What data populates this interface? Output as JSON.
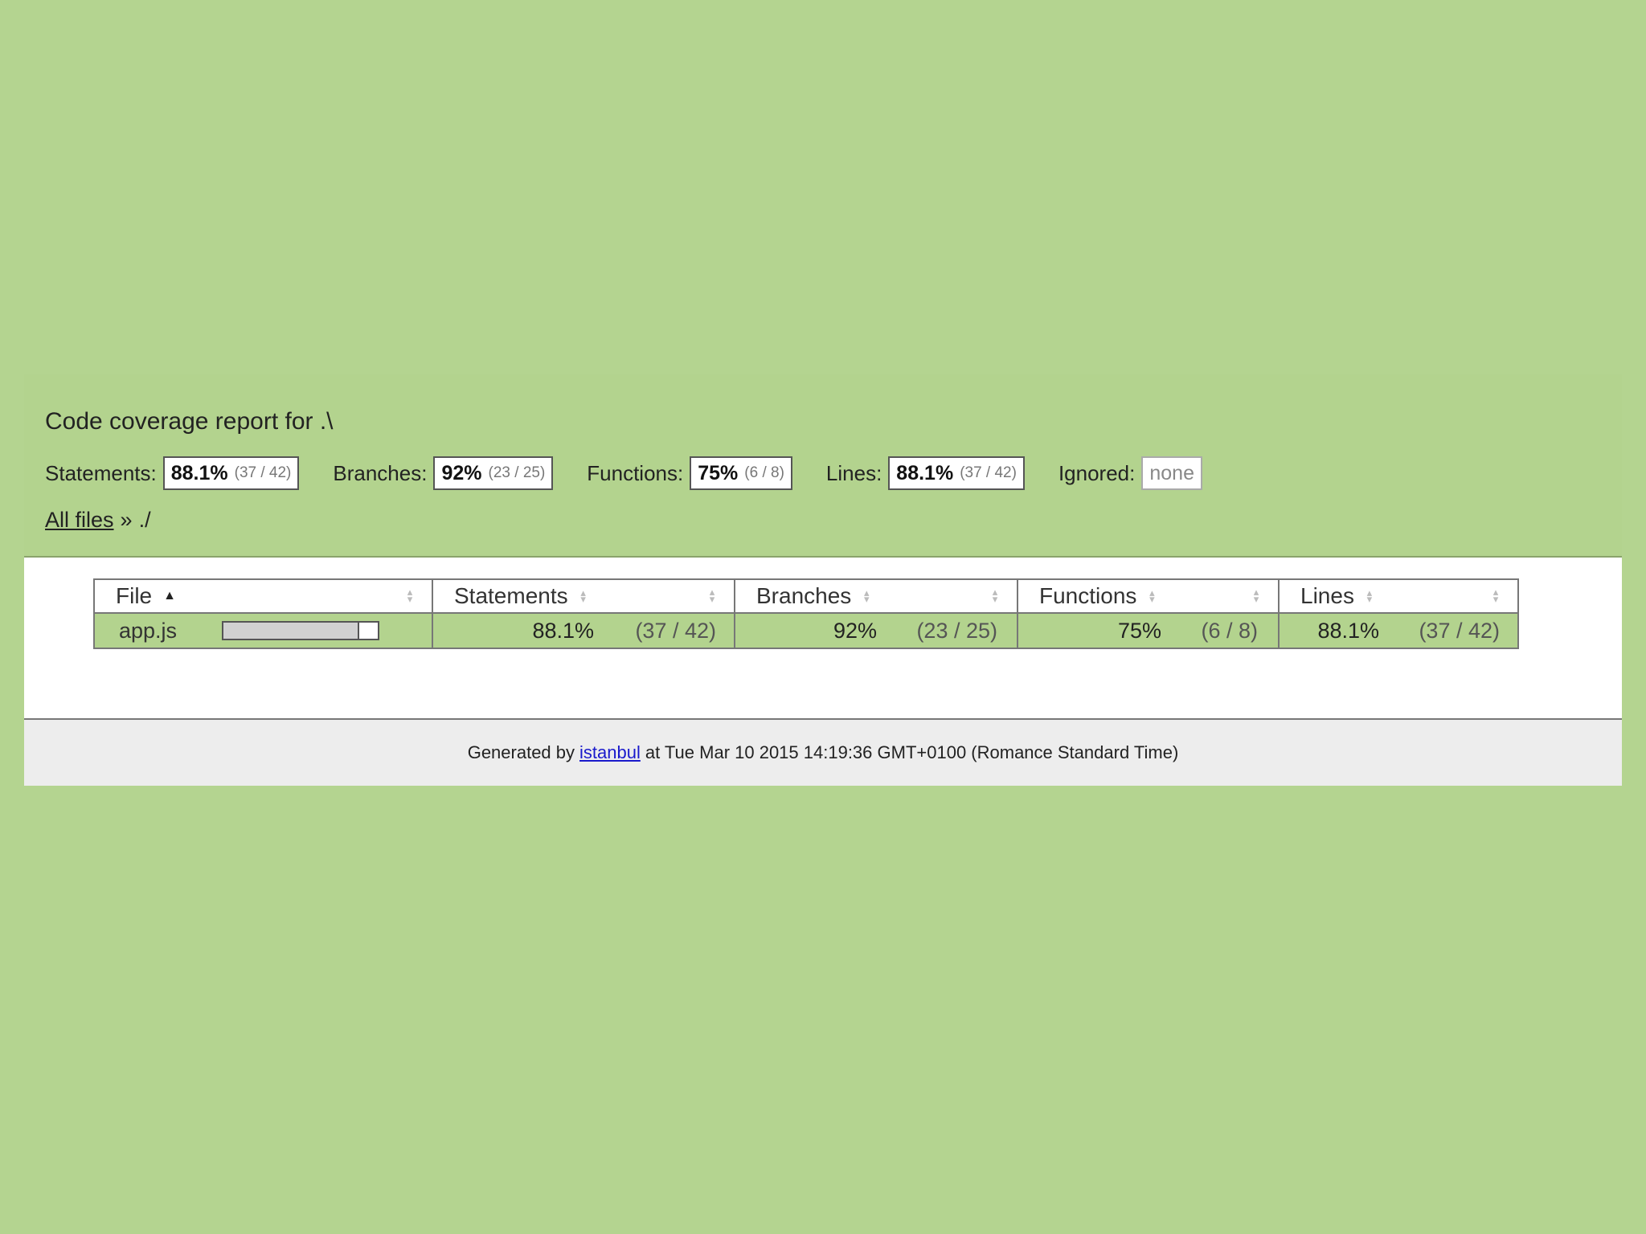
{
  "header": {
    "title": "Code coverage report for .\\",
    "summary": {
      "statements": {
        "label": "Statements:",
        "pct": "88.1%",
        "frac": "(37 / 42)"
      },
      "branches": {
        "label": "Branches:",
        "pct": "92%",
        "frac": "(23 / 25)"
      },
      "functions": {
        "label": "Functions:",
        "pct": "75%",
        "frac": "(6 / 8)"
      },
      "lines": {
        "label": "Lines:",
        "pct": "88.1%",
        "frac": "(37 / 42)"
      },
      "ignored": {
        "label": "Ignored:",
        "value": "none"
      }
    },
    "breadcrumb": {
      "root_label": "All files",
      "separator": "»",
      "current": "./"
    }
  },
  "table": {
    "columns": {
      "file": "File",
      "statements": "Statements",
      "branches": "Branches",
      "functions": "Functions",
      "lines": "Lines"
    },
    "rows": [
      {
        "file": "app.js",
        "bar_fraction": 0.881,
        "statements_pct": "88.1%",
        "statements_frac": "(37 / 42)",
        "branches_pct": "92%",
        "branches_frac": "(23 / 25)",
        "functions_pct": "75%",
        "functions_frac": "(6 / 8)",
        "lines_pct": "88.1%",
        "lines_frac": "(37 / 42)"
      }
    ]
  },
  "footer": {
    "prefix": "Generated by",
    "link": "istanbul",
    "suffix": "at Tue Mar 10 2015 14:19:36 GMT+0100 (Romance Standard Time)"
  },
  "colors": {
    "background": "#b4d490",
    "high_coverage": "#b3d38e",
    "medium_coverage": "#f9e784",
    "footer_bg": "#ededed",
    "link": "#1a1acc"
  }
}
